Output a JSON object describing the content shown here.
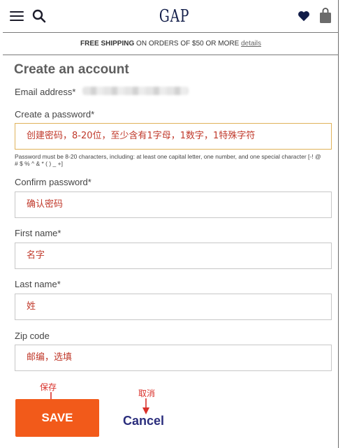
{
  "header": {
    "logo_text": "GAP",
    "menu_icon": "hamburger-menu-icon",
    "search_icon": "search-icon",
    "favorites_icon": "heart-icon",
    "bag_icon": "shopping-bag-icon"
  },
  "banner": {
    "bold": "FREE SHIPPING",
    "text": " ON ORDERS OF $50 OR MORE ",
    "link": "details"
  },
  "form": {
    "title": "Create an account",
    "email_label": "Email address*",
    "password_label": "Create a password*",
    "password_value": "创建密码，8-20位，至少含有1字母，1数字，1特殊字符",
    "password_hint": "Password must be 8-20 characters, including: at least one capital letter, one number, and one special character [-! @ # $ % ^ & * ( ) _ +]",
    "confirm_label": "Confirm password*",
    "confirm_value": "确认密码",
    "first_label": "First name*",
    "first_value": "名字",
    "last_label": "Last name*",
    "last_value": "姓",
    "zip_label": "Zip code",
    "zip_value": "邮编，选填"
  },
  "actions": {
    "save_label": "SAVE",
    "cancel_label": "Cancel"
  },
  "annotations": {
    "save_note": "保存",
    "cancel_note": "取消"
  },
  "colors": {
    "brand_navy": "#121d49",
    "save_orange": "#f25a1a",
    "cancel_blue": "#2a2d7c",
    "annotation_red": "#d9302a"
  }
}
